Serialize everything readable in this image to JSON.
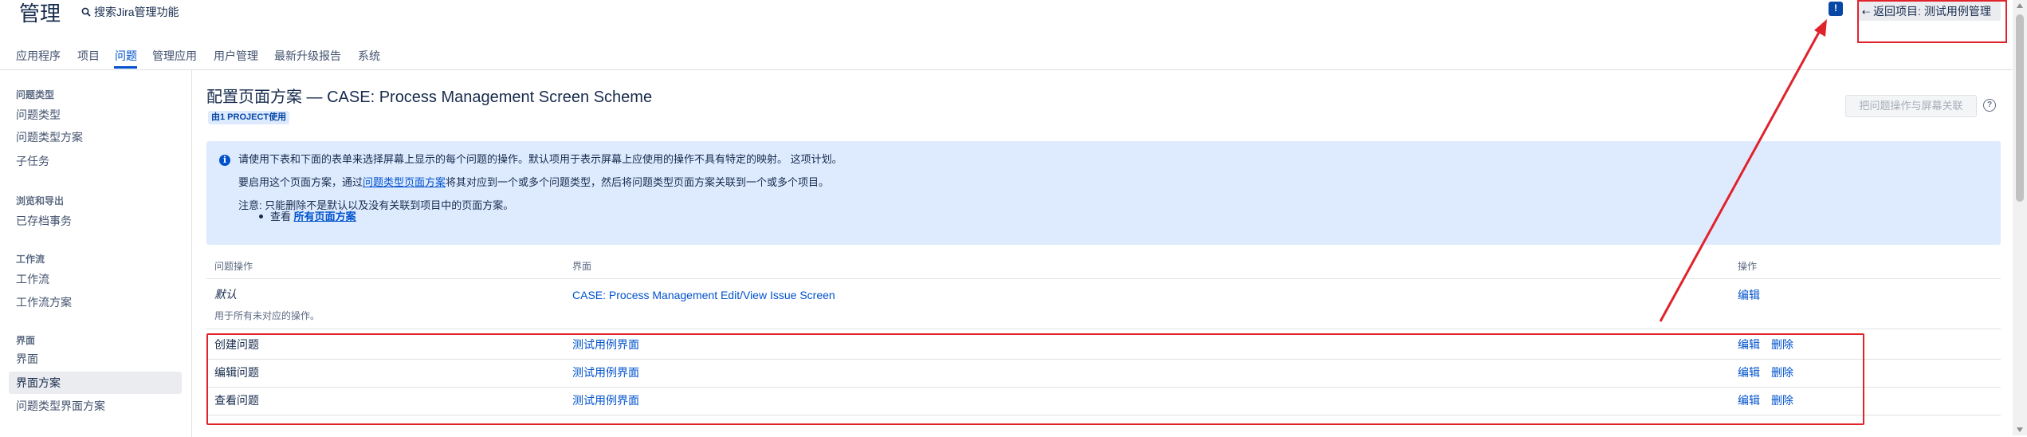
{
  "header": {
    "title": "管理",
    "search_label": "搜索Jira管理功能",
    "notify_glyph": "!",
    "back_label": "返回项目: 测试用例管理"
  },
  "nav": {
    "tabs": [
      "应用程序",
      "项目",
      "问题",
      "管理应用",
      "用户管理",
      "最新升级报告",
      "系统"
    ],
    "active": "问题"
  },
  "sidebar": {
    "sections": [
      {
        "heading": "问题类型",
        "items": [
          "问题类型",
          "问题类型方案",
          "子任务"
        ]
      },
      {
        "heading": "浏览和导出",
        "items": [
          "已存档事务"
        ]
      },
      {
        "heading": "工作流",
        "items": [
          "工作流",
          "工作流方案"
        ]
      },
      {
        "heading": "界面",
        "items": [
          "界面",
          "界面方案",
          "问题类型界面方案"
        ]
      }
    ],
    "active_item": "界面方案"
  },
  "page": {
    "title": "配置页面方案 — CASE: Process Management Screen Scheme",
    "shared_badge": "由1 PROJECT使用",
    "associate_button": "把问题操作与屏幕关联",
    "help_glyph": "?"
  },
  "info": {
    "icon_glyph": "i",
    "line1": "请使用下表和下面的表单来选择屏幕上显示的每个问题的操作。默认项用于表示屏幕上应使用的操作不具有特定的映射。 这项计划。",
    "line2_pre": "要启用这个页面方案，通过",
    "line2_link": "问题类型页面方案",
    "line2_post": "将其对应到一个或多个问题类型，然后将问题类型页面方案关联到一个或多个项目。",
    "line3": "注意: 只能删除不是默认以及没有关联到项目中的页面方案。",
    "line4_pre": "查看",
    "line4_link": "所有页面方案"
  },
  "table": {
    "headers": {
      "operation": "问题操作",
      "screen": "界面",
      "actions": "操作"
    },
    "default_row": {
      "operation": "默认",
      "description": "用于所有未对应的操作。",
      "screen": "CASE: Process Management Edit/View Issue Screen",
      "edit": "编辑"
    },
    "rows": [
      {
        "operation": "创建问题",
        "screen": "测试用例界面",
        "edit": "编辑",
        "delete": "删除"
      },
      {
        "operation": "编辑问题",
        "screen": "测试用例界面",
        "edit": "编辑",
        "delete": "删除"
      },
      {
        "operation": "查看问题",
        "screen": "测试用例界面",
        "edit": "编辑",
        "delete": "删除"
      }
    ]
  },
  "colors": {
    "accent": "#0052CC",
    "annotation_red": "#E0232B",
    "info_bg": "#DEEBFF"
  }
}
